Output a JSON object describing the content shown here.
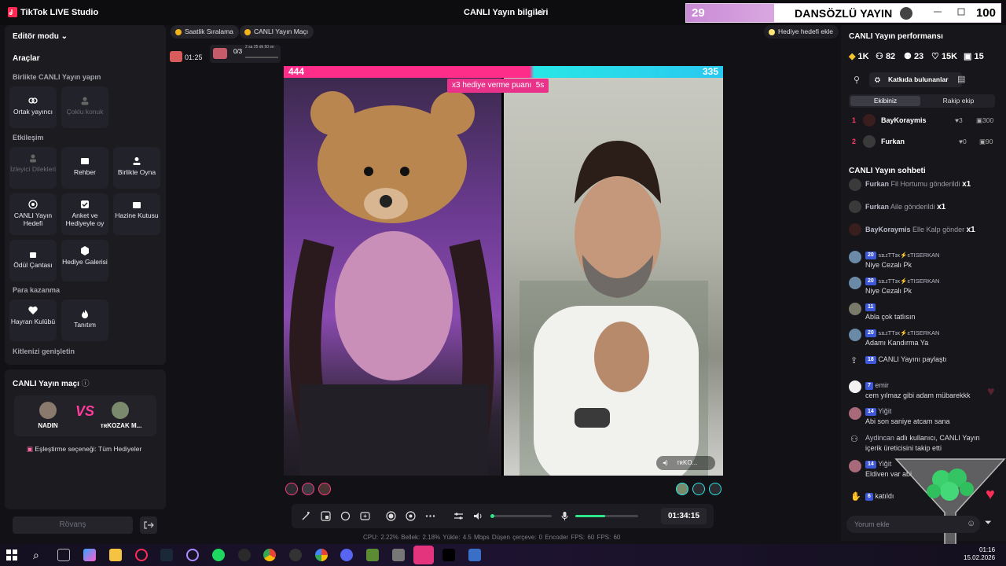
{
  "titlebar": {
    "app_title": "TikTok LIVE Studio",
    "live_info": "CANLI Yayın bilgileri",
    "overlay_count": "29",
    "overlay_name": "DANSÖZLÜ YAYIN",
    "overlay_score": "100"
  },
  "left": {
    "editor_mode": "Editör modu",
    "tools_title": "Araçlar",
    "section_collab": "Birlikte CANLI Yayın yapın",
    "co_host": "Ortak yayıncı",
    "multi_guest": "Çoklu konuk",
    "section_engage": "Etkileşim",
    "viewer_wishes": "İzleyici Dilekleri",
    "guide": "Rehber",
    "play_together": "Birlikte Oyna",
    "live_goal": "CANLI Yayın Hedefi",
    "poll": "Anket ve Hediyeyle oy",
    "treasure": "Hazine Kutusu",
    "reward_bag": "Ödül Çantası",
    "gift_gallery": "Hediye Galerisi",
    "section_monetize": "Para kazanma",
    "fan_club": "Hayran Kulübü",
    "promote": "Tanıtım",
    "section_expand": "Kitlenizi genişletin",
    "match_title": "CANLI Yayın maçı",
    "player1": "NADIN",
    "player2": "ᴛʀKOZAK M...",
    "match_option": "Eşleştirme seçeneği: Tüm Hediyeler",
    "rematch": "Rövanş"
  },
  "center": {
    "hourly_rank": "Saatlik Sıralama",
    "live_match": "CANLI Yayın Maçı",
    "add_gift_goal": "Hediye hedefi ekle",
    "box_timer": "01:25",
    "progress_label": "0/3",
    "progress_sub": "2 sa 25 dk 50 sn",
    "score_left": "444",
    "score_right": "335",
    "multiplier_text": "x3 hediye verme puanı",
    "multiplier_time": "5s",
    "right_tag": "ᴛʀKO...",
    "timer": "01:34:15",
    "stats": "CPU: 2.22%    Bellek: 2.18%    Yükle: 4.5 Mbps    Düşen çerçeve: 0    Encoder FPS: 60    FPS: 60"
  },
  "right": {
    "perf_title": "CANLI Yayın performansı",
    "metrics": [
      "1K",
      "82",
      "23",
      "15K",
      "15"
    ],
    "contributors": "Katkıda bulunanlar",
    "tab_team": "Ekibiniz",
    "tab_rival": "Rakip ekip",
    "ranks": [
      {
        "rank": "1",
        "name": "BayKoraymis",
        "likes": "3",
        "gifts": "300"
      },
      {
        "rank": "2",
        "name": "Furkan",
        "likes": "0",
        "gifts": "90"
      }
    ],
    "chat_title": "CANLI Yayın sohbeti",
    "gift_events": [
      {
        "name": "Furkan",
        "text": "Fil Hortumu gönderildi",
        "count": "x1"
      },
      {
        "name": "Furkan",
        "text": "Aile gönderildi",
        "count": "x1"
      },
      {
        "name": "BayKoraymis",
        "text": "Elle Kalp gönder",
        "count": "x1"
      }
    ],
    "messages": [
      {
        "badge": "20",
        "user": "ꜱɪʟɪTTɪᴋ⚡ɛTISERKAN",
        "text": "Niye Cezalı Pk"
      },
      {
        "badge": "20",
        "user": "ꜱɪʟɪTTɪᴋ⚡ɛTISERKAN",
        "text": "Niye Cezalı Pk"
      },
      {
        "badge": "11",
        "user": "",
        "text": "Abla çok tatlısın"
      },
      {
        "badge": "20",
        "user": "ꜱɪʟɪTTɪᴋ⚡ɛTISERKAN",
        "text": "Adamı Kandırma Ya"
      },
      {
        "badge": "18",
        "user": "",
        "text": "CANLI Yayını paylaştı"
      },
      {
        "badge": "7",
        "user": "emir",
        "text": "cem yılmaz gibi adam mübarekkk"
      },
      {
        "badge": "14",
        "user": "Yiğit",
        "text": "Abi son saniye atcam sana"
      },
      {
        "badge": "",
        "user": "Aydincan",
        "text": "adlı kullanıcı, CANLI Yayın içerik üreticisini takip etti"
      },
      {
        "badge": "14",
        "user": "Yiğit",
        "text": "Eldiven var abi"
      },
      {
        "badge": "6",
        "user": "",
        "text": "katıldı"
      }
    ],
    "comment_placeholder": "Yorum ekle"
  },
  "taskbar": {
    "clock_time": "01:16",
    "clock_date": "15.02.2026"
  },
  "colors": {
    "pink": "#ff2d8a",
    "cyan": "#29e6e6",
    "green": "#2ee68a",
    "badge_blue": "#3d58d8"
  }
}
